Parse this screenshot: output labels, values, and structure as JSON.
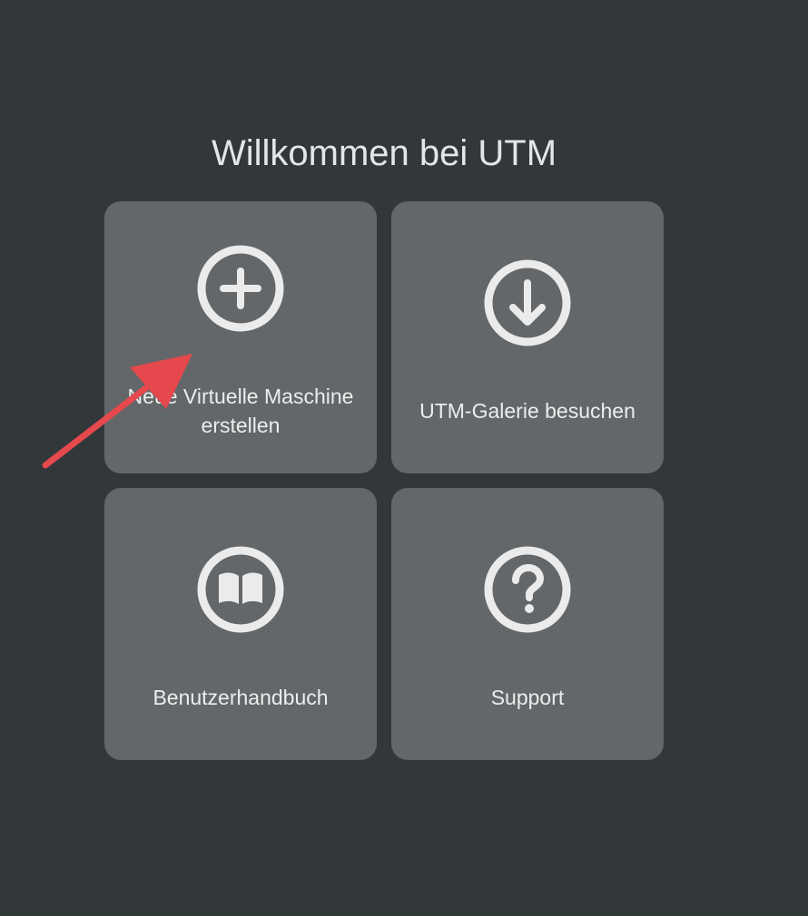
{
  "page": {
    "title": "Willkommen bei UTM"
  },
  "tiles": [
    {
      "label": "Neue Virtuelle Maschine erstellen",
      "icon": "plus-circle-icon"
    },
    {
      "label": "UTM-Galerie besuchen",
      "icon": "download-circle-icon"
    },
    {
      "label": "Benutzerhandbuch",
      "icon": "book-circle-icon"
    },
    {
      "label": "Support",
      "icon": "question-circle-icon"
    }
  ],
  "annotation": {
    "color": "#e5484d",
    "icon": "red-pointer-arrow"
  },
  "colors": {
    "background": "#32373a",
    "tile": "#636769",
    "text": "#eceded"
  }
}
